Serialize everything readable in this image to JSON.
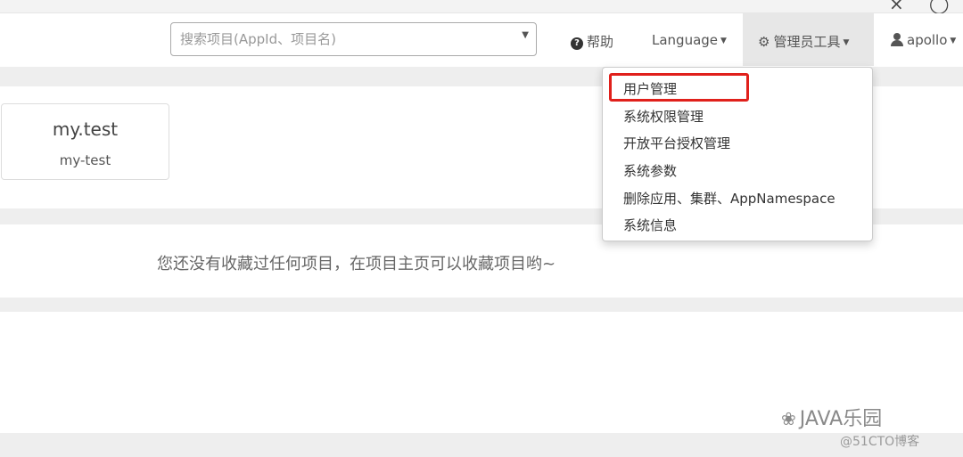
{
  "navbar": {
    "search": {
      "placeholder": "搜索项目(AppId、项目名)"
    },
    "help_label": "帮助",
    "language_label": "Language",
    "admin_tools_label": "管理员工具",
    "user_label": "apollo"
  },
  "project_card": {
    "name": "my.test",
    "id": "my-test"
  },
  "favorites": {
    "empty_message": "您还没有收藏过任何项目，在项目主页可以收藏项目哟~"
  },
  "admin_menu": {
    "items": [
      {
        "label": "用户管理",
        "highlighted": true
      },
      {
        "label": "系统权限管理"
      },
      {
        "label": "开放平台授权管理"
      },
      {
        "label": "系统参数"
      },
      {
        "label": "删除应用、集群、AppNamespace"
      },
      {
        "label": "系统信息"
      }
    ]
  },
  "watermark": {
    "line1": "JAVA乐园",
    "line2": "@51CTO博客"
  },
  "colors": {
    "highlight_border": "#e0201b",
    "band": "#eeeeee",
    "admin_active_bg": "#e7e7e7"
  }
}
